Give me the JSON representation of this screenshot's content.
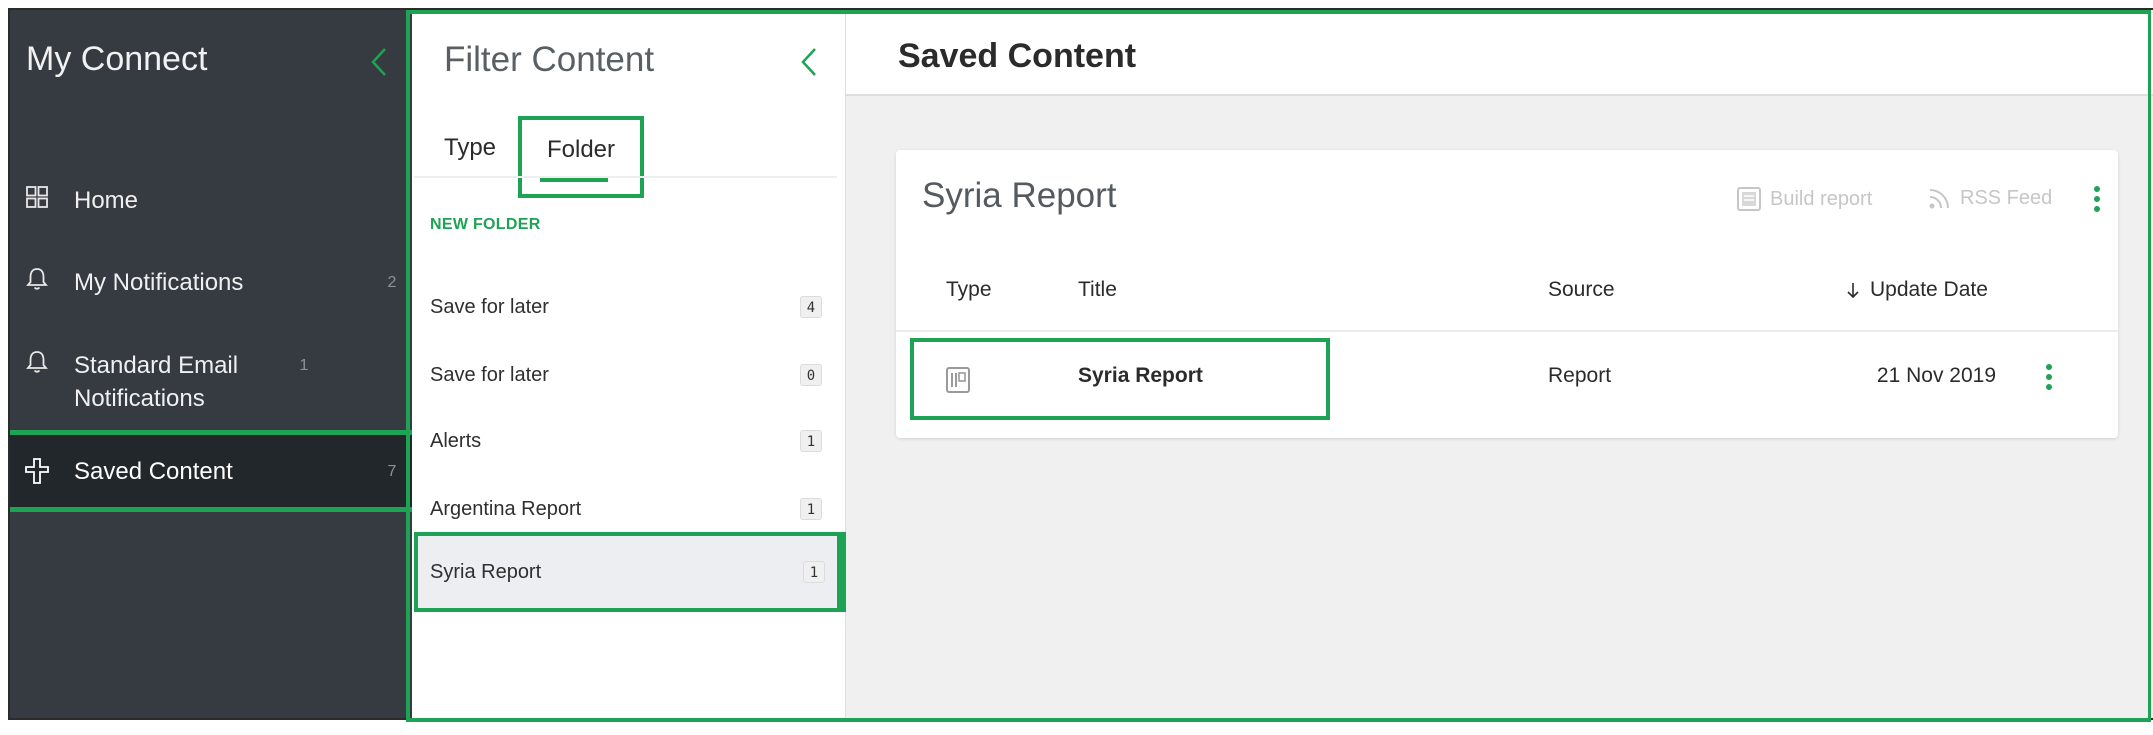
{
  "nav": {
    "title": "My Connect",
    "items": [
      {
        "label": "Home",
        "count": "",
        "icon": "grid-icon"
      },
      {
        "label": "My Notifications",
        "count": "2",
        "icon": "bell-icon"
      },
      {
        "label": "Standard Email Notifications",
        "count": "1",
        "icon": "bell-icon"
      },
      {
        "label": "Saved Content",
        "count": "7",
        "icon": "pin-icon"
      }
    ]
  },
  "filter": {
    "title": "Filter Content",
    "tabs": [
      {
        "label": "Type"
      },
      {
        "label": "Folder",
        "selected": true
      }
    ],
    "new_folder": "NEW FOLDER",
    "folders": [
      {
        "label": "Save for later",
        "count": "4"
      },
      {
        "label": "Save for later",
        "count": "0"
      },
      {
        "label": "Alerts",
        "count": "1"
      },
      {
        "label": "Argentina Report",
        "count": "1"
      },
      {
        "label": "Syria Report",
        "count": "1",
        "selected": true
      }
    ]
  },
  "main": {
    "title": "Saved Content",
    "card": {
      "title": "Syria Report",
      "actions": {
        "build_report": "Build report",
        "rss_feed": "RSS Feed"
      },
      "columns": {
        "type": "Type",
        "title": "Title",
        "source": "Source",
        "update_date": "Update Date"
      },
      "rows": [
        {
          "type_icon": "report-icon",
          "title": "Syria Report",
          "source": "Report",
          "update_date": "21 Nov 2019"
        }
      ]
    }
  },
  "colors": {
    "accent": "#1ea354",
    "nav_bg": "#353b41",
    "nav_selected_bg": "#22272b",
    "main_bg": "#f0f0f0"
  }
}
